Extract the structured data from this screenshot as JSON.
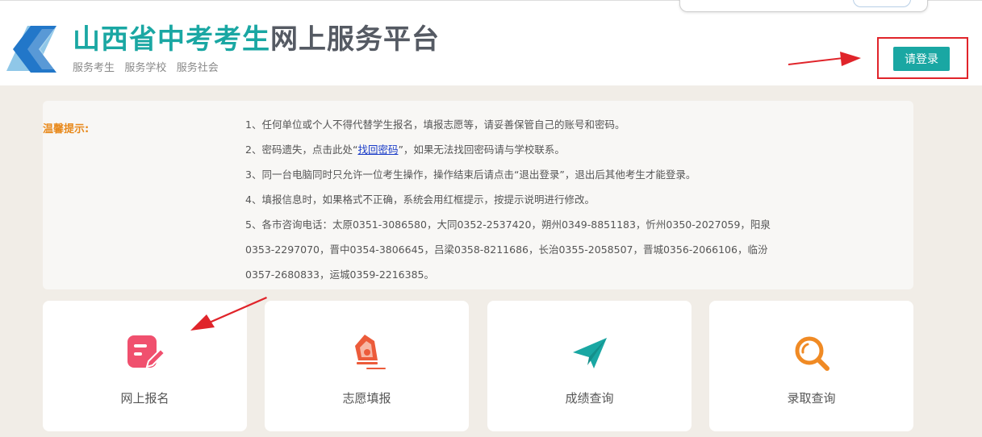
{
  "header": {
    "title_part1": "山西省中考考生",
    "title_part2": "网上服务平台",
    "subtitle": "服务考生   服务学校   服务社会",
    "login_label": "请登录"
  },
  "notice": {
    "label": "温馨提示:",
    "line1": "1、任何单位或个人不得代替学生报名，填报志愿等，请妥善保管自己的账号和密码。",
    "line2_before": "2、密码遗失，点击此处“",
    "line2_link": "找回密码",
    "line2_after": "”，如果无法找回密码请与学校联系。",
    "line3": "3、同一台电脑同时只允许一位考生操作，操作结束后请点击“退出登录”，退出后其他考生才能登录。",
    "line4": "4、填报信息时，如果格式不正确，系统会用红框提示，按提示说明进行修改。",
    "line5": "5、各市咨询电话：太原0351-3086580，大同0352-2537420，朔州0349-8851183，忻州0350-2027059，阳泉0353-2297070，晋中0354-3806645，吕梁0358-8211686，长治0355-2058507，晋城0356-2066106，临汾0357-2680833，运城0359-2216385。"
  },
  "cards": [
    {
      "label": "网上报名",
      "icon": "edit-icon",
      "color": "#f0506e"
    },
    {
      "label": "志愿填报",
      "icon": "pen-nib-icon",
      "color": "#ec5b3a"
    },
    {
      "label": "成绩查询",
      "icon": "paper-plane-icon",
      "color": "#1aa7a3"
    },
    {
      "label": "录取查询",
      "icon": "search-icon",
      "color": "#f08a24"
    }
  ],
  "colors": {
    "accent": "#1aa7a3",
    "highlight_red": "#e0242a",
    "notice_label": "#e88a1d",
    "page_bg": "#f1ede7"
  }
}
